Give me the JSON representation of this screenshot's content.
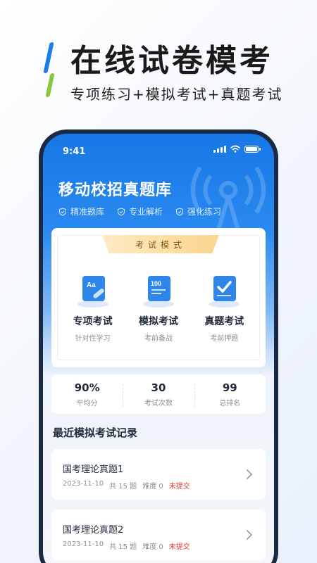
{
  "promo": {
    "headline": "在线试卷模考",
    "subline": "专项练习+模拟考试+真题考试"
  },
  "status_bar": {
    "time": "9:41"
  },
  "app": {
    "title": "移动校招真题库",
    "features": [
      "精准题库",
      "专业解析",
      "强化练习"
    ]
  },
  "mode_card": {
    "ribbon": "考试模式",
    "modes": [
      {
        "name": "专项考试",
        "desc": "针对性学习",
        "icon_text": "Aa"
      },
      {
        "name": "模拟考试",
        "desc": "考前备战",
        "icon_text": "100"
      },
      {
        "name": "真题考试",
        "desc": "考前押题",
        "icon_text": ""
      }
    ]
  },
  "stats": [
    {
      "value": "90%",
      "label": "平均分"
    },
    {
      "value": "30",
      "label": "考试次数"
    },
    {
      "value": "99",
      "label": "总排名"
    }
  ],
  "records_section": {
    "title": "最近模拟考试记录",
    "items": [
      {
        "title": "国考理论真题1",
        "date": "2023-11-10",
        "count": "共 15 题",
        "difficulty": "难度 0",
        "status": "未提交"
      },
      {
        "title": "国考理论真题2",
        "date": "2023-11-10",
        "count": "共 15 题",
        "difficulty": "难度 0",
        "status": "未提交"
      }
    ]
  },
  "colors": {
    "accent": "#1677e6",
    "slash_blue": "#1d7de6",
    "slash_green": "#8cc63f",
    "status_red": "#e03a3a",
    "ribbon_gold": "#fbd58e"
  }
}
